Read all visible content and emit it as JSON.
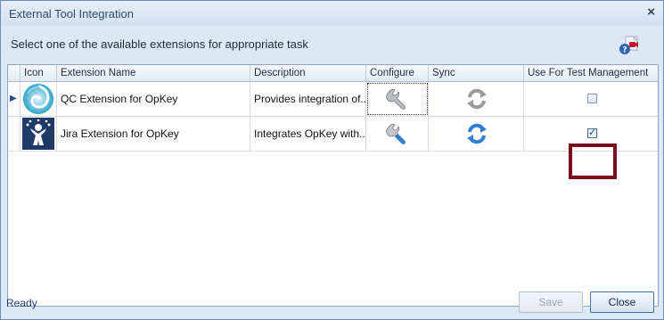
{
  "window": {
    "title": "External Tool Integration",
    "close_glyph": "×"
  },
  "instruction": "Select one of the available extensions for appropriate task",
  "grid": {
    "columns": [
      "Icon",
      "Extension Name",
      "Description",
      "Configure",
      "Sync",
      "Use For Test Management"
    ],
    "rows": [
      {
        "name": "QC Extension for OpKey",
        "description": "Provides integration of...",
        "use_for_test_management": false,
        "selected": true
      },
      {
        "name": "Jira Extension for OpKey",
        "description": "Integrates OpKey with...",
        "use_for_test_management": true,
        "selected": false
      }
    ]
  },
  "status": "Ready",
  "buttons": {
    "save": "Save",
    "close": "Close"
  },
  "icons": {
    "help": "help-video-icon",
    "qc": "qc-swirl-icon",
    "jira": "jira-person-icon",
    "configure": "wrench-icon",
    "sync": "sync-arrows-icon",
    "row_indicator": "row-indicator-arrow-icon"
  },
  "colors": {
    "highlight": "#7b0d1e",
    "sync_active": "#2d7fd3",
    "sync_inactive": "#9a9a9a"
  }
}
